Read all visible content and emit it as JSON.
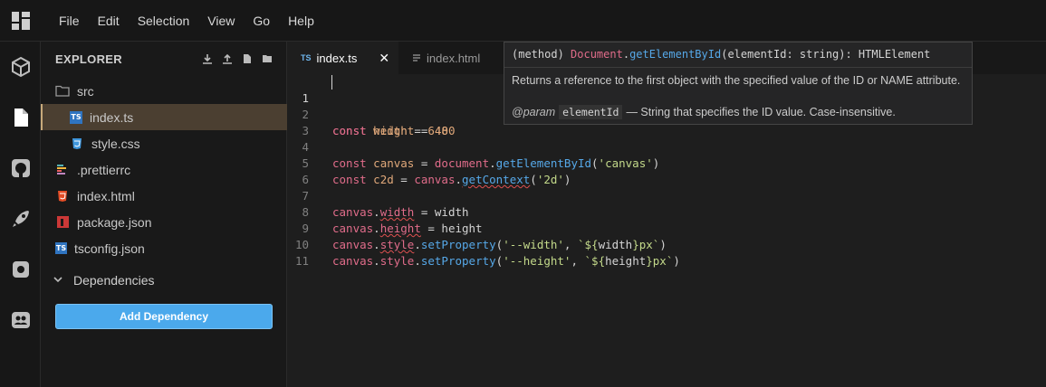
{
  "menubar": {
    "items": [
      "File",
      "Edit",
      "Selection",
      "View",
      "Go",
      "Help"
    ]
  },
  "activity_bar": {
    "icons": [
      "dashboard-logo-icon",
      "cube-icon",
      "file-icon",
      "github-icon",
      "rocket-icon",
      "gear-icon",
      "users-icon"
    ]
  },
  "sidebar": {
    "title": "EXPLORER",
    "tools": [
      "download-icon",
      "upload-icon",
      "new-file-icon",
      "new-folder-icon"
    ],
    "tree": [
      {
        "label": "src",
        "icon": "folder-icon"
      },
      {
        "label": "index.ts",
        "icon": "ts-file-icon"
      },
      {
        "label": "style.css",
        "icon": "css-file-icon"
      },
      {
        "label": ".prettierrc",
        "icon": "prettier-file-icon"
      },
      {
        "label": "index.html",
        "icon": "html-file-icon"
      },
      {
        "label": "package.json",
        "icon": "npm-file-icon"
      },
      {
        "label": "tsconfig.json",
        "icon": "ts-config-icon"
      }
    ],
    "dependencies_label": "Dependencies",
    "add_dependency_label": "Add Dependency"
  },
  "tabs": [
    {
      "label": "index.ts",
      "badge": "TS",
      "close": "✕"
    },
    {
      "label": "index.html"
    }
  ],
  "editor": {
    "line_numbers": [
      "1",
      "2",
      "3",
      "4",
      "5",
      "6",
      "7",
      "8",
      "9",
      "10",
      "11"
    ]
  },
  "tooltip": {
    "sig_prefix": "(method) ",
    "sig_class": "Document",
    "sig_dot": ".",
    "sig_method": "getElementById",
    "sig_rest": "(elementId: string): HTMLElement",
    "description": "Returns a reference to the first object with the specified value of the ID or NAME attribute.",
    "param_tag": "@param",
    "param_name": "elementId",
    "param_desc": "— String that specifies the ID value. Case-insensitive."
  },
  "colors": {
    "accent": "#4ba9ec",
    "active_row": "#4b3f31",
    "keyword": "#e06c8a",
    "variable": "#e0a87a",
    "function": "#56a8e8",
    "string": "#c3d98a"
  }
}
